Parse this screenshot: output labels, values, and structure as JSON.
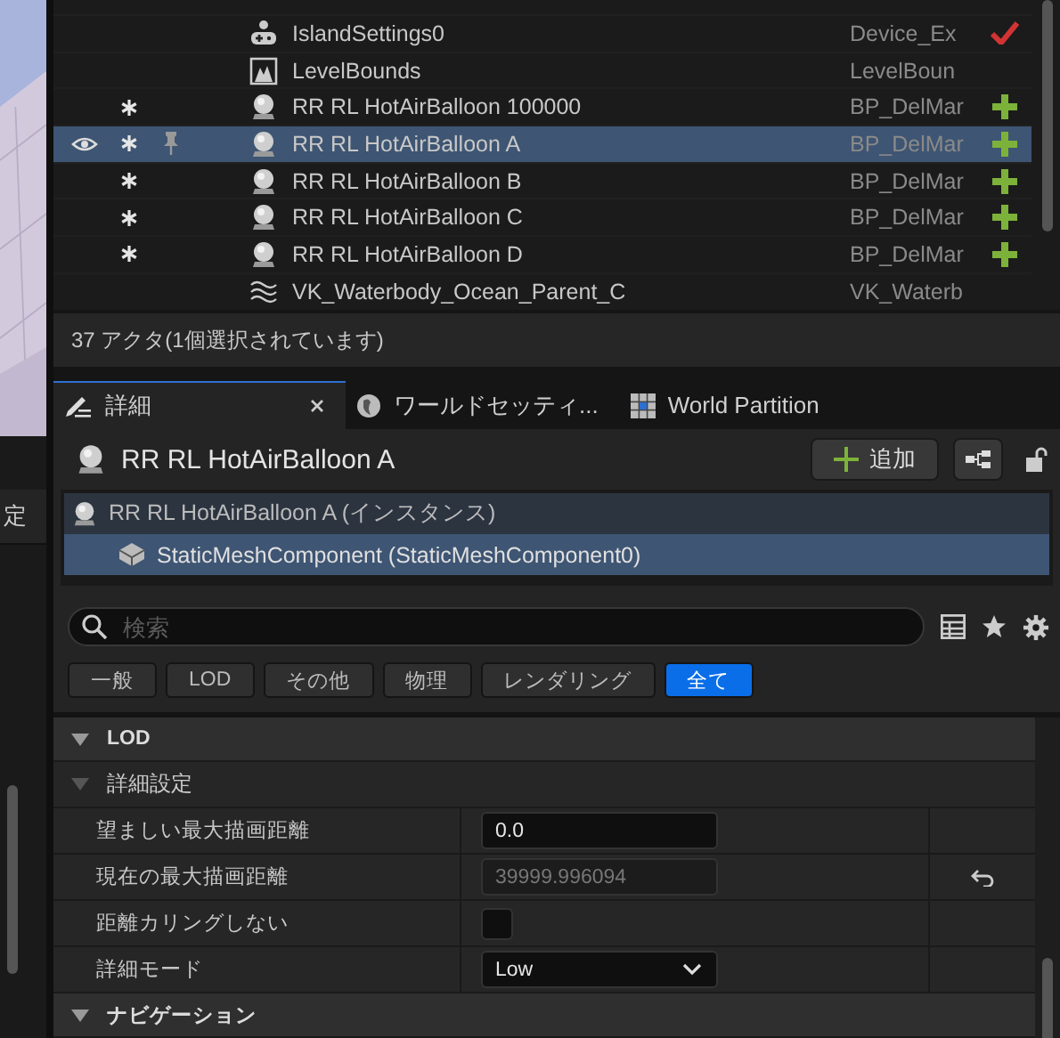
{
  "outliner": {
    "rows": [
      {
        "name": "IslandSettings0",
        "type": "Device_Ex",
        "kind": "gamepad",
        "visible": false,
        "modified": false,
        "pinned": false,
        "selected": false,
        "validated": true,
        "addable": false
      },
      {
        "name": "LevelBounds",
        "type": "LevelBoun",
        "kind": "bounds",
        "visible": false,
        "modified": false,
        "pinned": false,
        "selected": false,
        "validated": false,
        "addable": false
      },
      {
        "name": "RR RL HotAirBalloon 100000",
        "type": "BP_DelMar",
        "kind": "balloon",
        "visible": false,
        "modified": true,
        "pinned": false,
        "selected": false,
        "validated": false,
        "addable": true
      },
      {
        "name": "RR RL HotAirBalloon A",
        "type": "BP_DelMar",
        "kind": "balloon",
        "visible": true,
        "modified": true,
        "pinned": true,
        "selected": true,
        "validated": false,
        "addable": true
      },
      {
        "name": "RR RL HotAirBalloon B",
        "type": "BP_DelMar",
        "kind": "balloon",
        "visible": false,
        "modified": true,
        "pinned": false,
        "selected": false,
        "validated": false,
        "addable": true
      },
      {
        "name": "RR RL HotAirBalloon C",
        "type": "BP_DelMar",
        "kind": "balloon",
        "visible": false,
        "modified": true,
        "pinned": false,
        "selected": false,
        "validated": false,
        "addable": true
      },
      {
        "name": "RR RL HotAirBalloon D",
        "type": "BP_DelMar",
        "kind": "balloon",
        "visible": false,
        "modified": true,
        "pinned": false,
        "selected": false,
        "validated": false,
        "addable": true
      },
      {
        "name": "VK_Waterbody_Ocean_Parent_C",
        "type": "VK_Waterb",
        "kind": "waves",
        "visible": false,
        "modified": false,
        "pinned": false,
        "selected": false,
        "validated": false,
        "addable": false
      }
    ],
    "status": "37 アクタ(1個選択されています)"
  },
  "side_panel": {
    "label": "定"
  },
  "tabs": [
    {
      "label": "詳細",
      "kind": "details",
      "selected": true,
      "closable": true
    },
    {
      "label": "ワールドセッティ...",
      "kind": "globe",
      "selected": false,
      "closable": false
    },
    {
      "label": "World Partition",
      "kind": "grid",
      "selected": false,
      "closable": false
    }
  ],
  "details": {
    "title": "RR RL HotAirBalloon A",
    "add_button": "追加",
    "components": [
      {
        "label": "RR RL HotAirBalloon A (インスタンス)",
        "kind": "actor",
        "selected": false,
        "children": [
          {
            "label": "StaticMeshComponent (StaticMeshComponent0)",
            "kind": "mesh",
            "selected": true
          }
        ]
      }
    ],
    "search": {
      "placeholder": "検索"
    },
    "filters": [
      {
        "label": "一般",
        "selected": false
      },
      {
        "label": "LOD",
        "selected": false
      },
      {
        "label": "その他",
        "selected": false
      },
      {
        "label": "物理",
        "selected": false
      },
      {
        "label": "レンダリング",
        "selected": false
      },
      {
        "label": "全て",
        "selected": true
      }
    ],
    "rows": [
      {
        "kind": "section",
        "label": "LOD",
        "expanded": true
      },
      {
        "kind": "subsection",
        "label": "詳細設定",
        "expanded": true
      },
      {
        "kind": "number",
        "label": "望ましい最大描画距離",
        "value": "0.0",
        "disabled": false,
        "resettable": false
      },
      {
        "kind": "number",
        "label": "現在の最大描画距離",
        "value": "39999.996094",
        "disabled": true,
        "resettable": true
      },
      {
        "kind": "checkbox",
        "label": "距離カリングしない",
        "checked": false
      },
      {
        "kind": "dropdown",
        "label": "詳細モード",
        "value": "Low"
      },
      {
        "kind": "section",
        "label": "ナビゲーション",
        "expanded": true
      }
    ]
  }
}
